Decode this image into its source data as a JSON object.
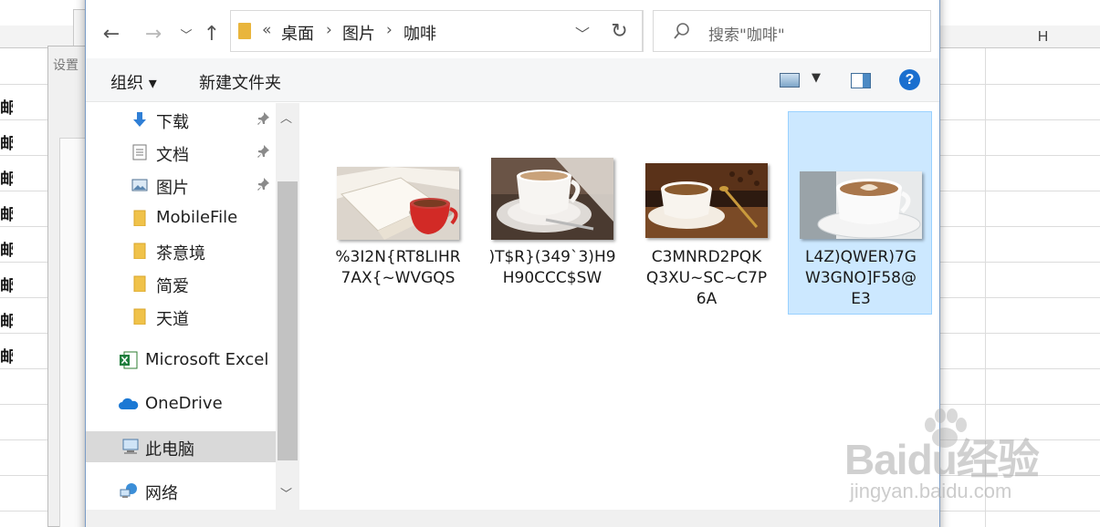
{
  "spreadsheet": {
    "column_header": "H",
    "left_cell_text": [
      "邮",
      "邮",
      "邮",
      "邮",
      "邮",
      "邮",
      "邮",
      "邮"
    ],
    "partial_label": "设置"
  },
  "dialog": {
    "address": {
      "overflow": "«",
      "crumbs": [
        "桌面",
        "图片",
        "咖啡"
      ]
    },
    "search": {
      "placeholder": "搜索\"咖啡\""
    },
    "toolbar": {
      "organize": "组织 ▾",
      "new_folder": "新建文件夹",
      "help": "?"
    },
    "nav": {
      "items": [
        {
          "label": "下载",
          "icon": "download-arrow-icon",
          "pinned": true
        },
        {
          "label": "文档",
          "icon": "document-icon",
          "pinned": true
        },
        {
          "label": "图片",
          "icon": "pictures-icon",
          "pinned": true
        },
        {
          "label": "MobileFile",
          "icon": "folder-icon",
          "pinned": false
        },
        {
          "label": "茶意境",
          "icon": "folder-icon",
          "pinned": false
        },
        {
          "label": "简爱",
          "icon": "folder-icon",
          "pinned": false
        },
        {
          "label": "天道",
          "icon": "folder-icon",
          "pinned": false
        },
        {
          "label": "Microsoft Excel",
          "icon": "excel-icon",
          "pinned": false
        },
        {
          "label": "OneDrive",
          "icon": "onedrive-cloud-icon",
          "pinned": false
        },
        {
          "label": "此电脑",
          "icon": "this-pc-icon",
          "pinned": false,
          "selected": true
        },
        {
          "label": "网络",
          "icon": "network-icon",
          "pinned": false
        }
      ]
    },
    "files": [
      {
        "name": "%3I2N{RT8LIHR7AX{~WVGQS",
        "lines": [
          "%3I2N{RT8LIHR",
          "7AX{~WVGQS"
        ],
        "selected": false
      },
      {
        "name": ")T$R}(349`3)H9H90CCC$SW",
        "lines": [
          ")T$R}(349`3)H9",
          "H90CCC$SW"
        ],
        "selected": false
      },
      {
        "name": "C3MNRD2PQKQ3XU~SC~C7P6A",
        "lines": [
          "C3MNRD2PQK",
          "Q3XU~SC~C7P",
          "6A"
        ],
        "selected": false
      },
      {
        "name": "L4Z)QWER)7GW3GNO]F58@E3",
        "lines": [
          "L4Z)QWER)7G",
          "W3GNO]F58@",
          "E3"
        ],
        "selected": true
      }
    ]
  },
  "watermark": {
    "brand": "Baidu经验",
    "sub": "jingyan.baidu.com"
  },
  "colors": {
    "selection_bg": "#cce8ff",
    "selection_border": "#99d1ff",
    "folder": "#e9b53c",
    "help_blue": "#1a6fcf"
  }
}
